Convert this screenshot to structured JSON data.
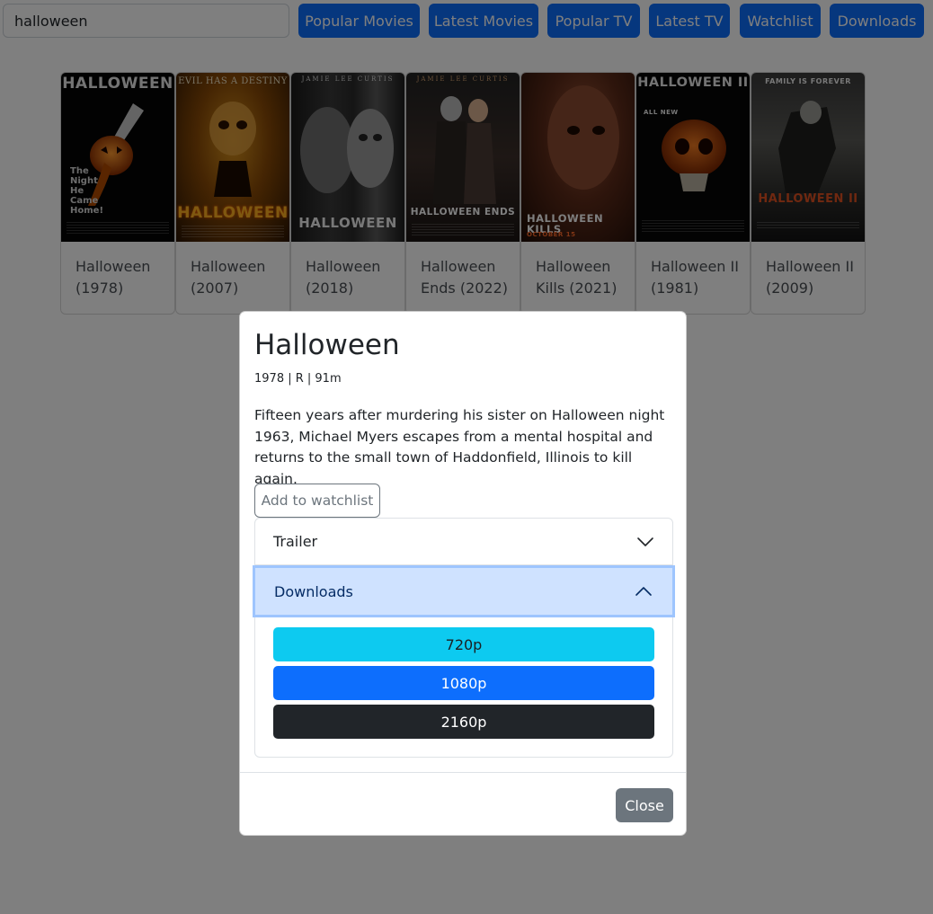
{
  "search": {
    "value": "halloween"
  },
  "nav": {
    "popular_movies": "Popular Movies",
    "latest_movies": "Latest Movies",
    "popular_tv": "Popular TV",
    "latest_tv": "Latest TV",
    "watchlist": "Watchlist",
    "downloads": "Downloads"
  },
  "movies": [
    {
      "title": "Halloween (1978)",
      "poster_headline": "HALLOWEEN",
      "poster_tagline": "The Night He Came Home!"
    },
    {
      "title": "Halloween (2007)",
      "poster_headline": "HALLOWEEN",
      "poster_tagline": "EVIL HAS A DESTINY"
    },
    {
      "title": "Halloween (2018)",
      "poster_headline": "HALLOWEEN",
      "poster_tagline": "JAMIE LEE CURTIS"
    },
    {
      "title": "Halloween Ends (2022)",
      "poster_headline": "HALLOWEEN ENDS",
      "poster_tagline": "JAMIE LEE CURTIS"
    },
    {
      "title": "Halloween Kills (2021)",
      "poster_headline": "HALLOWEEN KILLS",
      "poster_tagline": "OCTOBER 15"
    },
    {
      "title": "Halloween II (1981)",
      "poster_headline": "HALLOWEEN II",
      "poster_tagline": "ALL NEW"
    },
    {
      "title": "Halloween II (2009)",
      "poster_headline": "HALLOWEEN II",
      "poster_tagline": "FAMILY IS FOREVER"
    }
  ],
  "modal": {
    "title": "Halloween",
    "meta": "1978 | R | 91m",
    "description": "Fifteen years after murdering his sister on Halloween night 1963, Michael Myers escapes from a mental hospital and returns to the small town of Haddonfield, Illinois to kill again.",
    "watchlist_button": "Add to watchlist",
    "accordion": {
      "trailer_label": "Trailer",
      "downloads_label": "Downloads",
      "downloads": [
        {
          "label": "720p",
          "color": "#0dcaf0"
        },
        {
          "label": "1080p",
          "color": "#0d6efd"
        },
        {
          "label": "2160p",
          "color": "#212529"
        }
      ]
    },
    "close_button": "Close"
  },
  "colors": {
    "primary": "#0d6efd",
    "secondary": "#6c757d",
    "info": "#0dcaf0",
    "dark": "#212529",
    "accordion_active_bg": "#cfe2ff"
  }
}
